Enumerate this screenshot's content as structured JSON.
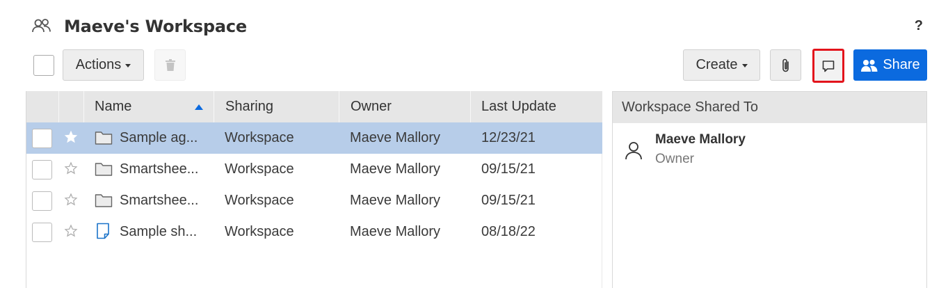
{
  "header": {
    "title": "Maeve's Workspace",
    "help": "?"
  },
  "toolbar": {
    "actions_label": "Actions",
    "create_label": "Create",
    "share_label": "Share",
    "share_color": "#0b6adf",
    "highlight_color": "#e3141c"
  },
  "grid": {
    "columns": [
      "Name",
      "Sharing",
      "Owner",
      "Last Update"
    ],
    "sort": {
      "column": "Name",
      "direction": "ascending"
    },
    "rows": [
      {
        "name": "Sample ag...",
        "type": "folder",
        "sharing": "Workspace",
        "owner": "Maeve Mallory",
        "updated": "12/23/21",
        "selected": true
      },
      {
        "name": "Smartshee...",
        "type": "folder",
        "sharing": "Workspace",
        "owner": "Maeve Mallory",
        "updated": "09/15/21",
        "selected": false
      },
      {
        "name": "Smartshee...",
        "type": "folder",
        "sharing": "Workspace",
        "owner": "Maeve Mallory",
        "updated": "09/15/21",
        "selected": false
      },
      {
        "name": "Sample sh...",
        "type": "sheet",
        "sharing": "Workspace",
        "owner": "Maeve Mallory",
        "updated": "08/18/22",
        "selected": false
      }
    ]
  },
  "panel": {
    "title": "Workspace Shared To",
    "members": [
      {
        "name": "Maeve Mallory",
        "role": "Owner"
      }
    ]
  }
}
